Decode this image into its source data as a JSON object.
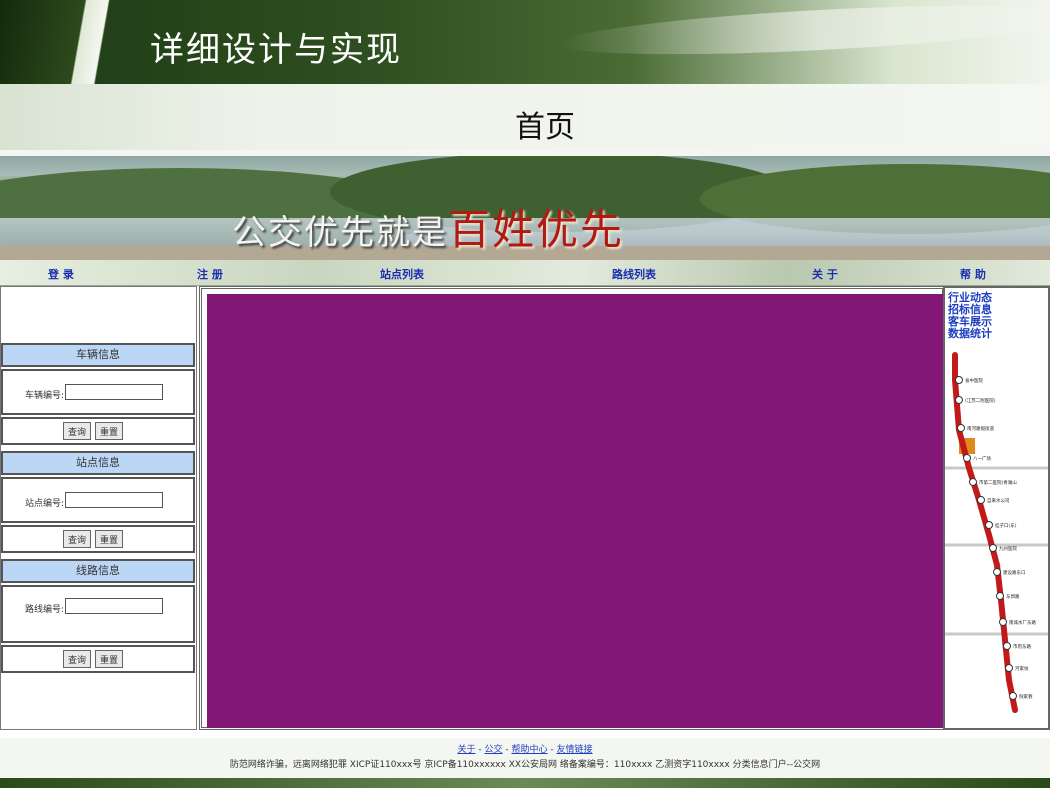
{
  "slide": {
    "title": "详细设计与实现",
    "subtitle": "首页"
  },
  "banner": {
    "slogan_white": "公交优先就是",
    "slogan_red": "百姓优先"
  },
  "nav": [
    {
      "label": "登 录"
    },
    {
      "label": "注 册"
    },
    {
      "label": "站点列表"
    },
    {
      "label": "路线列表"
    },
    {
      "label": "关 于"
    },
    {
      "label": "帮 助"
    }
  ],
  "left_panel": {
    "sections": [
      {
        "header": "车辆信息",
        "field_label": "车辆编号:",
        "field_value": "",
        "query_label": "查询",
        "reset_label": "重置"
      },
      {
        "header": "站点信息",
        "field_label": "站点编号:",
        "field_value": "",
        "query_label": "查询",
        "reset_label": "重置"
      },
      {
        "header": "线路信息",
        "field_label": "路线编号:",
        "field_value": "",
        "query_label": "查询",
        "reset_label": "重置"
      }
    ]
  },
  "content": {
    "background": "#831775"
  },
  "right_panel": {
    "links": [
      "行业动态",
      "招标信息",
      "客车展示",
      "数据统计"
    ],
    "map_stops": [
      "省中医院",
      "(江苏二附医院)",
      "南河路假街道",
      "八一广场",
      "市第二医院(青湖山",
      "自来水公司",
      "桂子口(东)",
      "九州医院",
      "建设路东口",
      "东郭路",
      "南城水厂东路",
      "市府东路",
      "河家坊",
      "倪家巷"
    ],
    "line_color": "#c21a1a"
  },
  "footer": {
    "links": [
      "关于",
      "公交",
      "帮助中心",
      "友情链接"
    ],
    "separator": "-",
    "legal": "防范网络诈骗，远离网络犯罪 XICP证110xxx号 京ICP备110xxxxxx XX公安局网 络备案编号：110xxxx 乙测资字110xxxx 分类信息门户--公交网"
  }
}
